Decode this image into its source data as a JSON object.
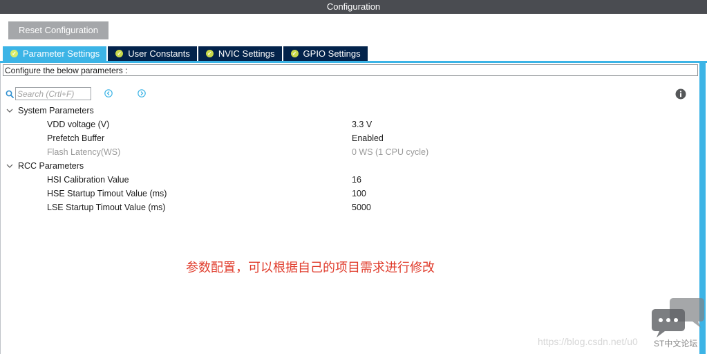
{
  "window": {
    "title": "Configuration"
  },
  "toolbar": {
    "reset_label": "Reset Configuration"
  },
  "tabs": [
    {
      "label": "Parameter Settings",
      "active": true
    },
    {
      "label": "User Constants",
      "active": false
    },
    {
      "label": "NVIC Settings",
      "active": false
    },
    {
      "label": "GPIO Settings",
      "active": false
    }
  ],
  "panel": {
    "description": "Configure the below parameters :",
    "search": {
      "placeholder": "Search (Crtl+F)",
      "value": ""
    }
  },
  "groups": [
    {
      "label": "System Parameters",
      "params": [
        {
          "name": "VDD voltage (V)",
          "value": "3.3 V",
          "enabled": true
        },
        {
          "name": "Prefetch Buffer",
          "value": "Enabled",
          "enabled": true
        },
        {
          "name": "Flash Latency(WS)",
          "value": "0 WS (1 CPU cycle)",
          "enabled": false
        }
      ]
    },
    {
      "label": "RCC Parameters",
      "params": [
        {
          "name": "HSI Calibration Value",
          "value": "16",
          "enabled": true
        },
        {
          "name": "HSE Startup Timout Value (ms)",
          "value": "100",
          "enabled": true
        },
        {
          "name": "LSE Startup Timout Value (ms)",
          "value": "5000",
          "enabled": true
        }
      ]
    }
  ],
  "annotation": "参数配置，可以根据自己的项目需求进行修改",
  "watermark": {
    "url": "https://blog.csdn.net/u0",
    "forum": "ST中文论坛"
  },
  "colors": {
    "accent": "#3cb4e6",
    "tab_dark": "#03234b",
    "titlebar": "#4a4c51",
    "annotation": "#e03b2b"
  }
}
